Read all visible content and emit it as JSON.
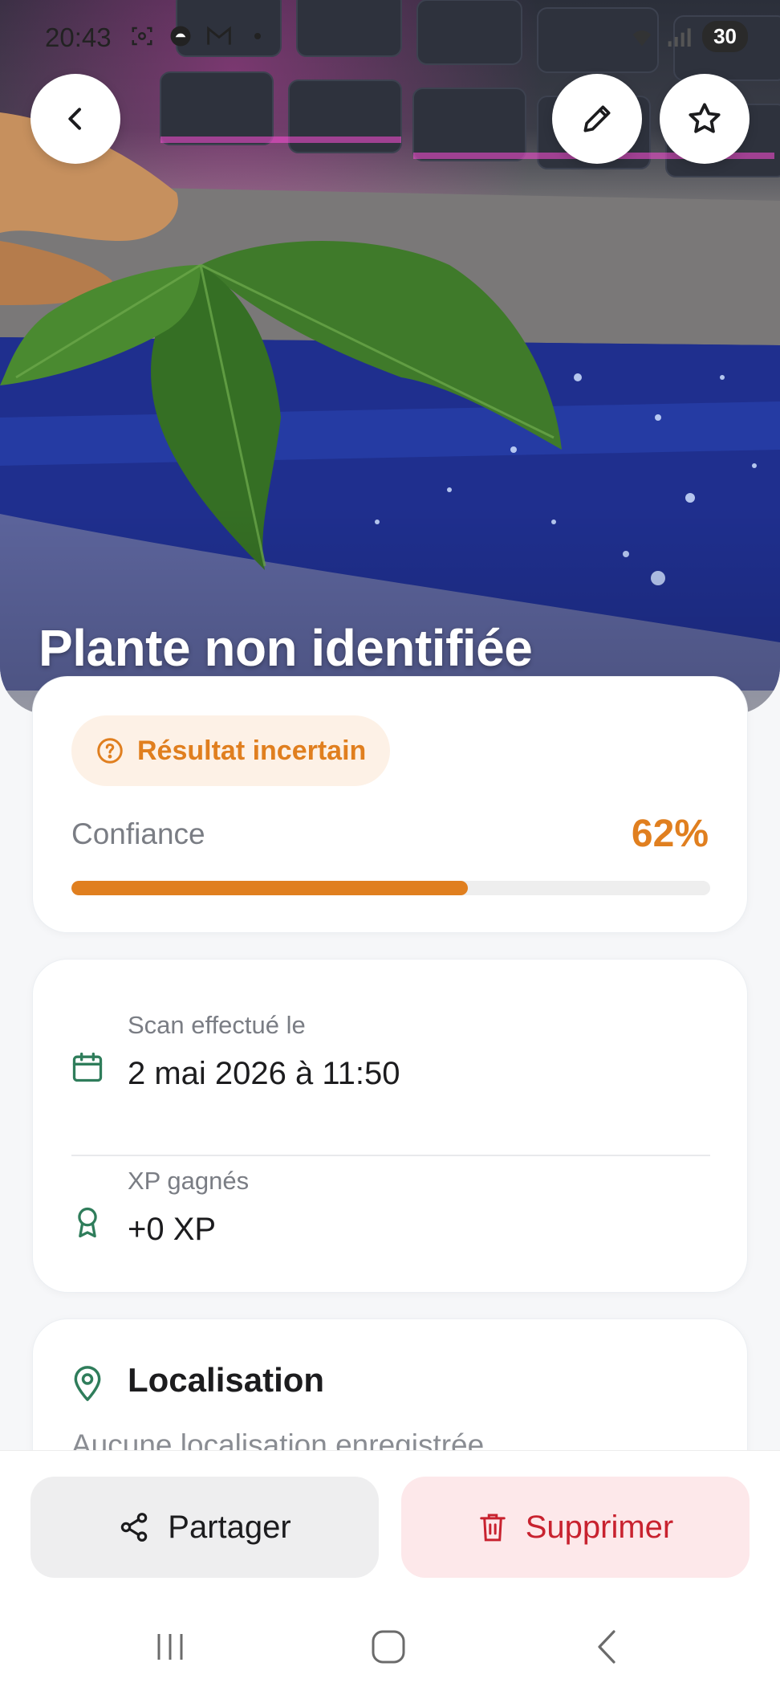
{
  "status_bar": {
    "time": "20:43",
    "battery": "30"
  },
  "hero": {
    "title": "Plante non identifiée"
  },
  "confidence_card": {
    "badge": "Résultat incertain",
    "label": "Confiance",
    "value_text": "62%",
    "value": 0.62,
    "accent_color": "#e07f1f"
  },
  "info_card": {
    "scan_label": "Scan effectué le",
    "scan_value": "2 mai 2026 à 11:50",
    "xp_label": "XP gagnés",
    "xp_value": "+0 XP",
    "icon_color": "#2f7d5b"
  },
  "location_card": {
    "title": "Localisation",
    "empty_text": "Aucune localisation enregistrée"
  },
  "actions": {
    "share_label": "Partager",
    "delete_label": "Supprimer",
    "delete_color": "#c8222f"
  }
}
